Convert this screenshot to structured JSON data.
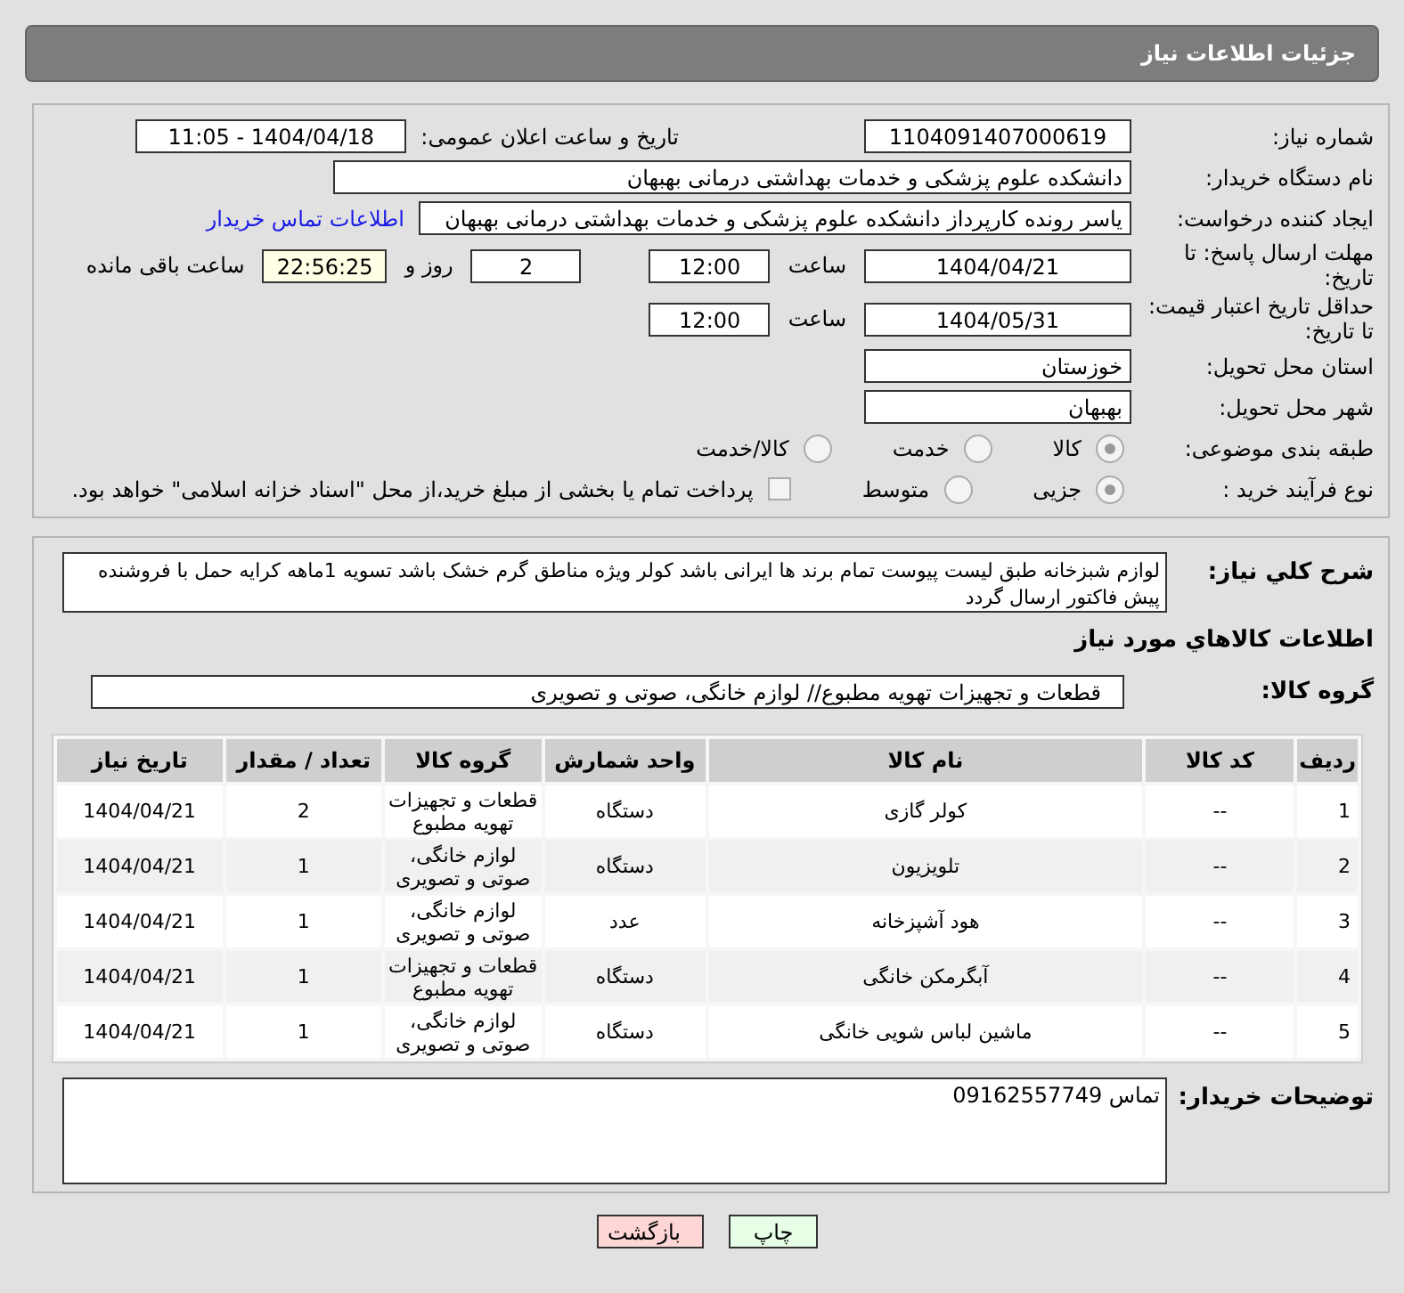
{
  "header": {
    "title": "جزئیات اطلاعات نیاز"
  },
  "need_number": {
    "label": "شماره نیاز:",
    "value": "1104091407000619"
  },
  "announce": {
    "label": "تاریخ و ساعت اعلان عمومی:",
    "value": "1404/04/18 - 11:05"
  },
  "buyer_org": {
    "label": "نام دستگاه خریدار:",
    "value": "دانشکده علوم پزشکی و خدمات بهداشتی  درمانی بهبهان"
  },
  "creator": {
    "label": "ایجاد کننده درخواست:",
    "value": "یاسر رونده کارپرداز دانشکده علوم پزشکی و خدمات بهداشتی  درمانی بهبهان",
    "link": "اطلاعات تماس خریدار"
  },
  "deadline": {
    "label": "مهلت ارسال پاسخ: تا تاریخ:",
    "date": "1404/04/21",
    "time_label": "ساعت",
    "time": "12:00",
    "days": "2",
    "days_label": "روز و",
    "remaining": "22:56:25",
    "remaining_label": "ساعت باقی مانده"
  },
  "validity": {
    "label": "حداقل تاریخ اعتبار قیمت: تا تاریخ:",
    "date": "1404/05/31",
    "time_label": "ساعت",
    "time": "12:00"
  },
  "province": {
    "label": "استان محل تحویل:",
    "value": "خوزستان"
  },
  "city": {
    "label": "شهر محل تحویل:",
    "value": "بهبهان"
  },
  "category": {
    "label": "طبقه بندی موضوعی:",
    "options": [
      {
        "label": "کالا",
        "selected": true
      },
      {
        "label": "خدمت",
        "selected": false
      },
      {
        "label": "کالا/خدمت",
        "selected": false
      }
    ]
  },
  "process": {
    "label": "نوع فرآیند خرید :",
    "options": [
      {
        "label": "جزیی",
        "selected": true
      },
      {
        "label": "متوسط",
        "selected": false
      }
    ],
    "checkbox": {
      "label": "پرداخت تمام یا بخشی از مبلغ خرید،از محل \"اسناد خزانه اسلامی\" خواهد بود.",
      "checked": false
    }
  },
  "description": {
    "label": "شرح کلي نياز:",
    "value": "لوازم شبزخانه طبق لیست پیوست تمام برند ها ایرانی باشد کولر ویژه مناطق گرم خشک باشد تسویه 1ماهه کرایه حمل با فروشنده پیش فاکتور ارسال گردد"
  },
  "goods_title": "اطلاعات کالاهاي مورد نياز",
  "goods_group": {
    "label": "گروه کالا:",
    "value": "قطعات و تجهیزات تهویه مطبوع// لوازم خانگی، صوتی و تصویری"
  },
  "table": {
    "columns": [
      "ردیف",
      "کد کالا",
      "نام کالا",
      "واحد شمارش",
      "گروه کالا",
      "تعداد / مقدار",
      "تاریخ نیاز"
    ],
    "rows": [
      [
        "1",
        "--",
        "کولر گازی",
        "دستگاه",
        "قطعات و تجهیزات تهویه مطبوع",
        "2",
        "1404/04/21"
      ],
      [
        "2",
        "--",
        "تلویزیون",
        "دستگاه",
        "لوازم خانگی، صوتی و تصویری",
        "1",
        "1404/04/21"
      ],
      [
        "3",
        "--",
        "هود آشپزخانه",
        "عدد",
        "لوازم خانگی، صوتی و تصویری",
        "1",
        "1404/04/21"
      ],
      [
        "4",
        "--",
        "آبگرمکن خانگی",
        "دستگاه",
        "قطعات و تجهیزات تهویه مطبوع",
        "1",
        "1404/04/21"
      ],
      [
        "5",
        "--",
        "ماشین لباس شویی خانگی",
        "دستگاه",
        "لوازم خانگی، صوتی و تصویری",
        "1",
        "1404/04/21"
      ]
    ]
  },
  "buyer_notes": {
    "label": "توضیحات خریدار:",
    "value": "تماس 09162557749"
  },
  "buttons": [
    {
      "label": "چاپ",
      "kind": "print"
    },
    {
      "label": "بازگشت",
      "kind": "back"
    }
  ]
}
